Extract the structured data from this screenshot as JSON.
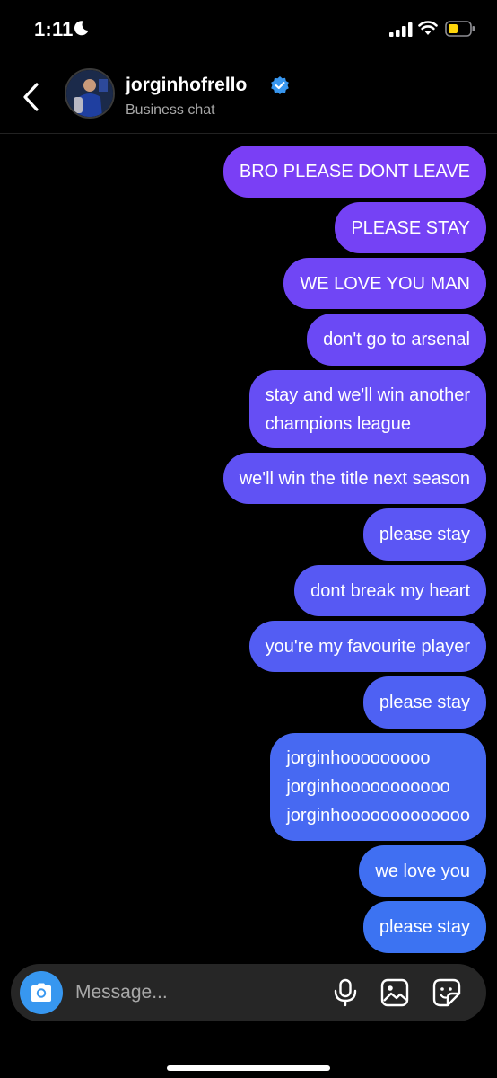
{
  "status_bar": {
    "time": "1:11"
  },
  "header": {
    "contact_name": "jorginhofrello",
    "subtitle": "Business chat"
  },
  "messages": [
    {
      "text": "BRO PLEASE DONT LEAVE",
      "color": "#7a3ff5"
    },
    {
      "text": "PLEASE STAY",
      "color": "#7542f5"
    },
    {
      "text": "WE LOVE YOU MAN",
      "color": "#7046f5"
    },
    {
      "text": "don't go to arsenal",
      "color": "#6b49f5"
    },
    {
      "text": "stay and we'll win another\nchampions league",
      "color": "#664ef4"
    },
    {
      "text": "we'll win the title next season",
      "color": "#6052f4"
    },
    {
      "text": "please stay",
      "color": "#5b56f4"
    },
    {
      "text": "dont break my heart",
      "color": "#5759f3"
    },
    {
      "text": "you're my favourite player",
      "color": "#535df3"
    },
    {
      "text": "please stay",
      "color": "#4e61f3"
    },
    {
      "text": "jorginhooooooooo\njorginhooooooooooo\njorginhooooooooooooo",
      "color": "#4769f2"
    },
    {
      "text": "we love you",
      "color": "#406ff2"
    },
    {
      "text": "please stay",
      "color": "#3c73f2"
    }
  ],
  "composer": {
    "placeholder": "Message..."
  },
  "colors": {
    "accent": "#3797f0",
    "background": "#000000",
    "composer_bg": "#262626",
    "battery": "#ffd60a"
  }
}
